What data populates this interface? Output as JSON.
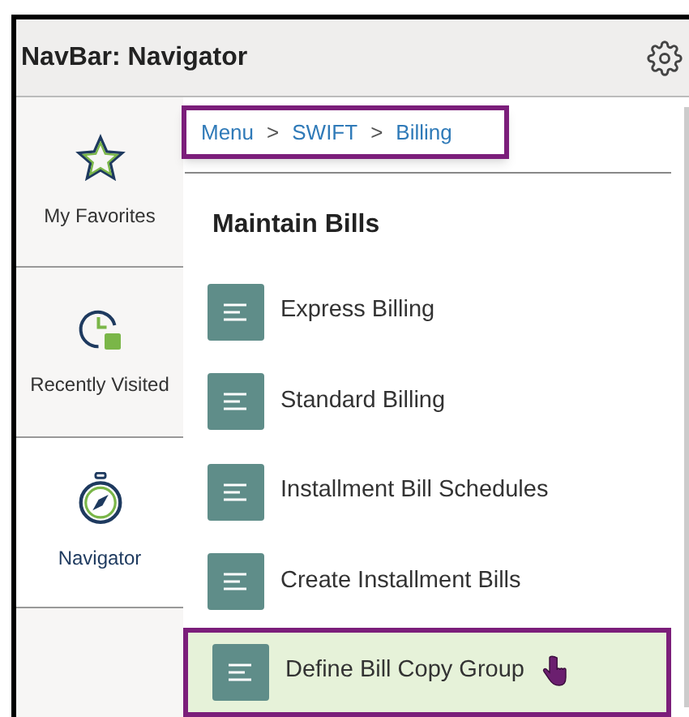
{
  "window": {
    "title": "NavBar: Navigator"
  },
  "sidebar": {
    "items": [
      {
        "kind": "favorites",
        "label": "My Favorites",
        "selected": false
      },
      {
        "kind": "recent",
        "label": "Recently Visited",
        "selected": false
      },
      {
        "kind": "navigator",
        "label": "Navigator",
        "selected": true
      }
    ]
  },
  "breadcrumb": {
    "highlighted": true,
    "items": [
      "Menu",
      "SWIFT",
      "Billing"
    ],
    "separator": ">"
  },
  "section": {
    "title": "Maintain Bills",
    "items": [
      {
        "label": "Express Billing",
        "selected": false
      },
      {
        "label": "Standard Billing",
        "selected": false
      },
      {
        "label": "Installment Bill Schedules",
        "selected": false
      },
      {
        "label": "Create Installment Bills",
        "selected": false
      },
      {
        "label": "Define Bill Copy Group",
        "selected": true
      }
    ]
  }
}
